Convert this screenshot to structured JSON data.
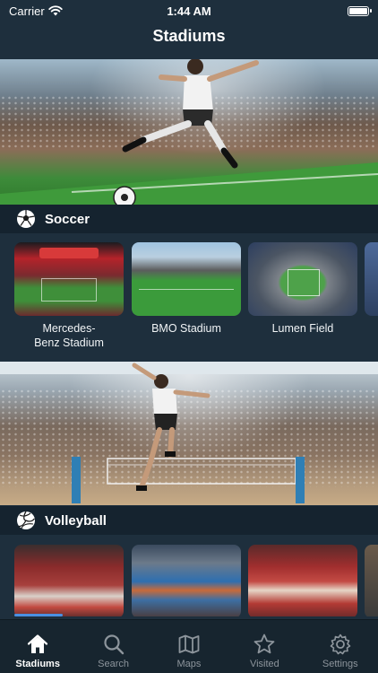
{
  "status_bar": {
    "carrier": "Carrier",
    "time": "1:44 AM"
  },
  "nav": {
    "title": "Stadiums"
  },
  "sections": [
    {
      "label": "Soccer",
      "icon": "soccer-ball-icon",
      "cards": [
        {
          "name": "Mercedes-\nBenz Stadium",
          "line1": "Mercedes-",
          "line2": "Benz Stadium"
        },
        {
          "name": "BMO Stadium",
          "line1": "BMO Stadium",
          "line2": ""
        },
        {
          "name": "Lumen Field",
          "line1": "Lumen Field",
          "line2": ""
        }
      ]
    },
    {
      "label": "Volleyball",
      "icon": "volleyball-icon",
      "cards": []
    }
  ],
  "tabs": [
    {
      "label": "Stadiums",
      "icon": "home-icon",
      "active": true
    },
    {
      "label": "Search",
      "icon": "search-icon",
      "active": false
    },
    {
      "label": "Maps",
      "icon": "map-icon",
      "active": false
    },
    {
      "label": "Visited",
      "icon": "star-icon",
      "active": false
    },
    {
      "label": "Settings",
      "icon": "gear-icon",
      "active": false
    }
  ],
  "colors": {
    "background": "#1e2f3d",
    "header_bar": "#15232f",
    "accent": "#4a90e2",
    "tab_inactive": "#8d959c"
  }
}
